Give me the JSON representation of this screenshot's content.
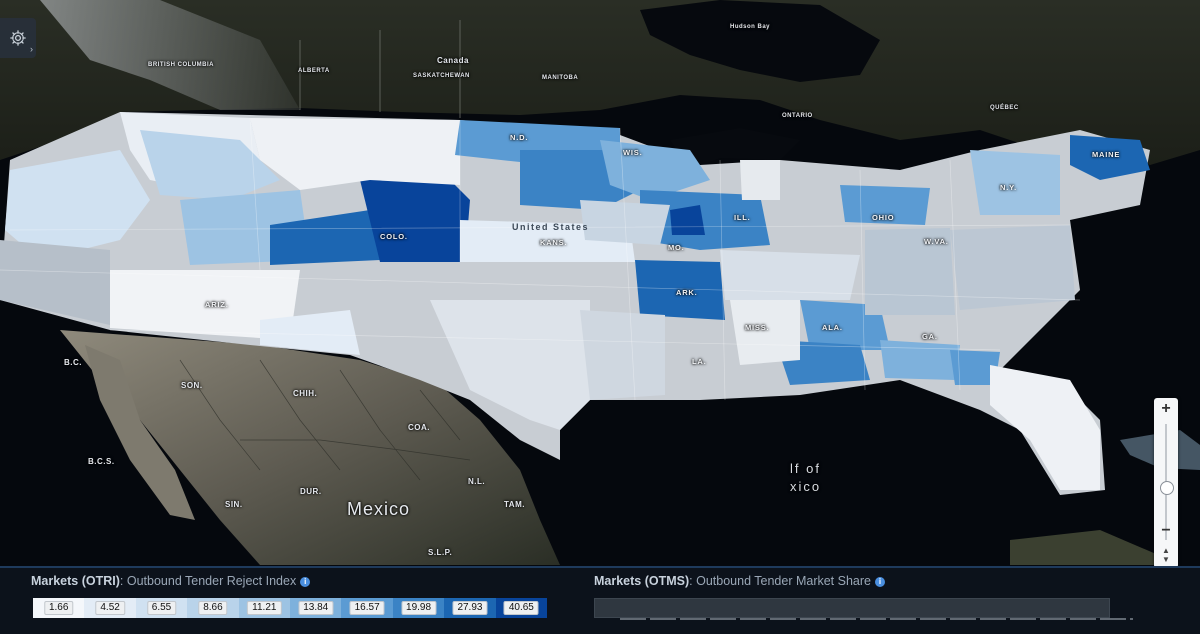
{
  "map": {
    "labels": {
      "canada": "Canada",
      "alberta": "ALBERTA",
      "saskatchewan": "SASKATCHEWAN",
      "manitoba": "MANITOBA",
      "british_columbia": "BRITISH COLUMBIA",
      "ontario": "ONTARIO",
      "hudson_bay": "Hudson Bay",
      "quebec": "QUÉBEC",
      "united_states": "United States",
      "mexico": "Mexico",
      "son": "SON.",
      "chih": "CHIH.",
      "coa": "COA.",
      "dur": "DUR.",
      "sin": "SIN.",
      "bcs": "B.C.S.",
      "bc": "B.C.",
      "nl": "N.L.",
      "tam": "TAM.",
      "slp": "S.L.P.",
      "gulf_1": "lf of",
      "gulf_2": "xico",
      "states": {
        "kans": "KANS.",
        "mo": "MO.",
        "ark": "ARK.",
        "miss": "MISS.",
        "ala": "ALA.",
        "ga": "GA.",
        "la": "LA.",
        "ohio": "OHIO",
        "ill": "ILL.",
        "ny": "N.Y.",
        "maine": "MAINE",
        "colo": "COLO.",
        "ariz": "ARIZ.",
        "wva": "W.VA.",
        "nd": "N.D.",
        "wis": "WIS."
      }
    }
  },
  "legend": {
    "otri": {
      "prefix": "Markets (OTRI)",
      "title": "Outbound Tender Reject Index",
      "breaks": [
        "1.66",
        "4.52",
        "6.55",
        "8.66",
        "11.21",
        "13.84",
        "16.57",
        "19.98",
        "27.93",
        "40.65"
      ],
      "colors": [
        "#f4f7fb",
        "#e3ecf6",
        "#d0e1f1",
        "#b9d3ea",
        "#9dc3e3",
        "#7eb1dc",
        "#5b9bd3",
        "#3b83c5",
        "#1c66b2",
        "#08449b"
      ]
    },
    "otms": {
      "prefix": "Markets (OTMS)",
      "title": "Outbound Tender Market Share"
    }
  },
  "colors": {
    "ocean": "#05080d",
    "land": "#23271f",
    "legend_bg": "#0c121b",
    "info_icon": "#4a8fe0"
  },
  "icons": {
    "settings": "gear-icon",
    "zoom_in": "plus-icon",
    "zoom_out": "minus-icon",
    "compass": "compass-icon",
    "info": "info-icon"
  },
  "zoom": {
    "plus": "+",
    "minus": "−",
    "level": 0.45
  }
}
